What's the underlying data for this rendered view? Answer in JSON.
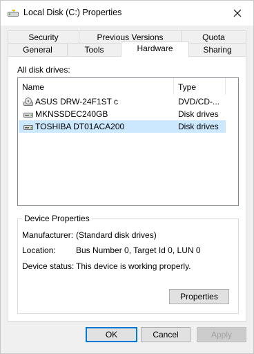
{
  "window": {
    "title": "Local Disk (C:) Properties"
  },
  "tabs": {
    "row_top": [
      {
        "label": "Security"
      },
      {
        "label": "Previous Versions"
      },
      {
        "label": "Quota"
      }
    ],
    "row_bottom": [
      {
        "label": "General"
      },
      {
        "label": "Tools"
      },
      {
        "label": "Hardware",
        "active": true
      },
      {
        "label": "Sharing"
      }
    ]
  },
  "hardware": {
    "all_drives_label": "All disk drives:",
    "columns": {
      "name": "Name",
      "type": "Type"
    },
    "drives": [
      {
        "name": "ASUS DRW-24F1ST   c",
        "type": "DVD/CD-...",
        "icon": "dvd-drive-icon"
      },
      {
        "name": "MKNSSDEC240GB",
        "type": "Disk drives",
        "icon": "disk-drive-icon"
      },
      {
        "name": "TOSHIBA DT01ACA200",
        "type": "Disk drives",
        "icon": "disk-drive-icon",
        "selected": true
      }
    ],
    "device_properties": {
      "title": "Device Properties",
      "manufacturer_label": "Manufacturer:",
      "manufacturer_value": "(Standard disk drives)",
      "location_label": "Location:",
      "location_value": "Bus Number 0, Target Id 0, LUN 0",
      "status_label": "Device status:",
      "status_value": "This device is working properly.",
      "properties_button": "Properties"
    }
  },
  "footer": {
    "ok": "OK",
    "cancel": "Cancel",
    "apply": "Apply"
  },
  "colors": {
    "selection": "#cce8ff",
    "default_button_border": "#0078d7"
  }
}
